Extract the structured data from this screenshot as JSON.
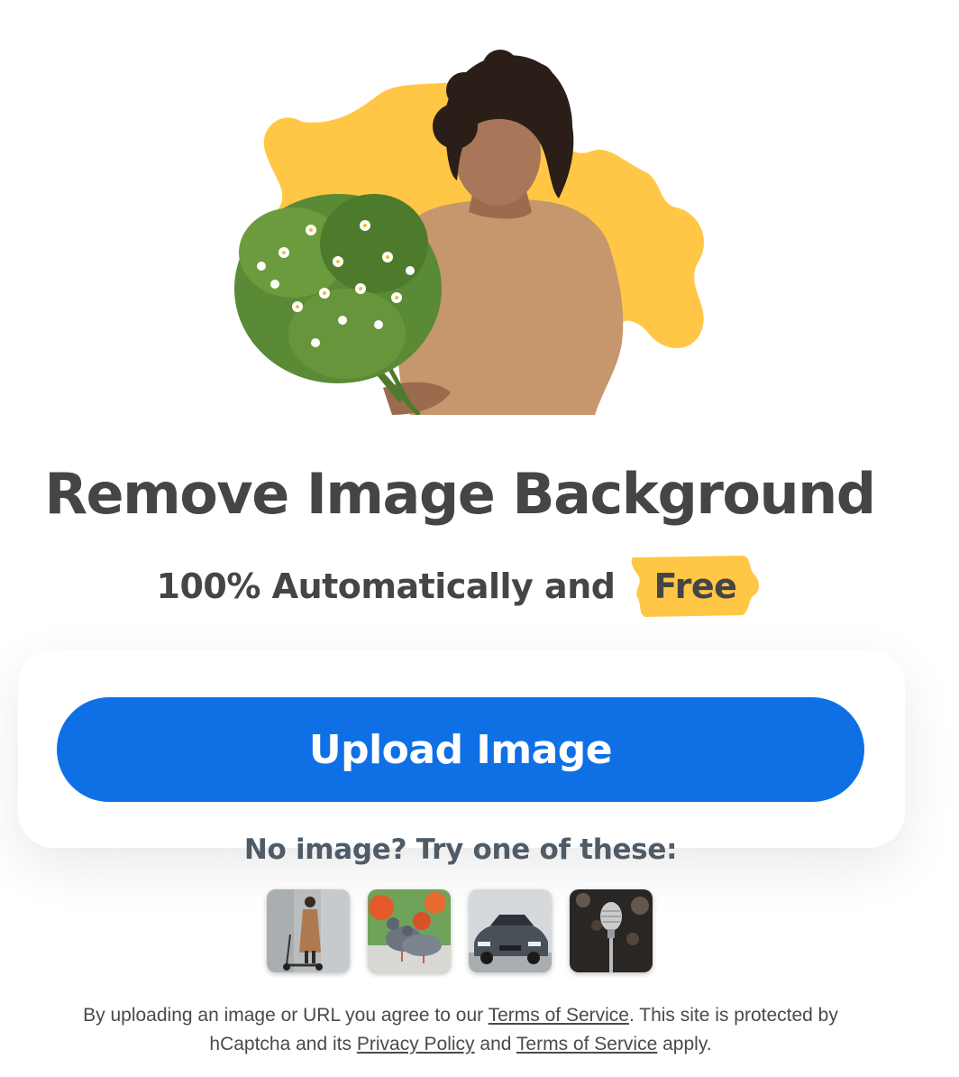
{
  "hero": {
    "image": "woman-holding-flowers-illustration",
    "blob_color": "#FFC745"
  },
  "heading": {
    "title": "Remove Image Background",
    "subtitle": "100% Automatically and",
    "highlight": "Free",
    "highlight_color": "#FFC745"
  },
  "upload": {
    "button_label": "Upload Image",
    "button_color": "#0F70E6"
  },
  "samples": {
    "label": "No image? Try one of these:",
    "items": [
      {
        "icon": "woman-with-scooter-thumbnail"
      },
      {
        "icon": "pigeons-thumbnail"
      },
      {
        "icon": "car-thumbnail"
      },
      {
        "icon": "microphone-thumbnail"
      }
    ]
  },
  "legal": {
    "text_1": "By uploading an image or URL you agree to our",
    "link_terms_1": "Terms of Service",
    "text_2": ". This site is protected by hCaptcha and its",
    "link_privacy": "Privacy Policy",
    "text_3": "and",
    "link_terms_2": "Terms of Service",
    "text_4": "apply."
  }
}
